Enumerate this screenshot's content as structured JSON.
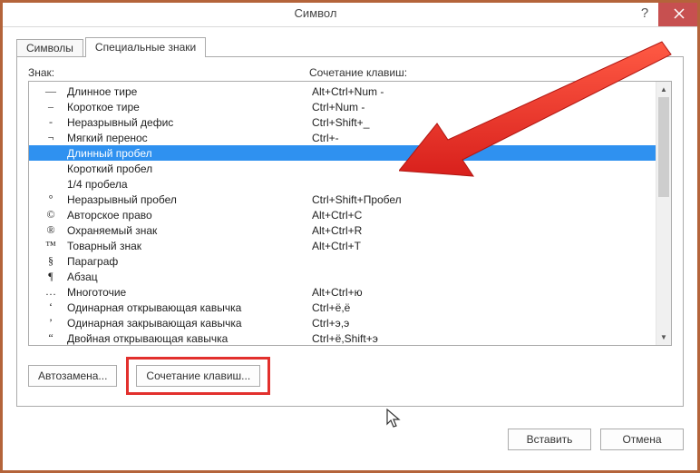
{
  "window": {
    "title": "Символ"
  },
  "tabs": {
    "symbols": "Символы",
    "special": "Специальные знаки"
  },
  "headers": {
    "sign": "Знак:",
    "shortcut": "Сочетание клавиш:"
  },
  "rows": [
    {
      "sym": "—",
      "name": "Длинное тире",
      "key": "Alt+Ctrl+Num -",
      "selected": false
    },
    {
      "sym": "–",
      "name": "Короткое тире",
      "key": "Ctrl+Num -",
      "selected": false
    },
    {
      "sym": "-",
      "name": "Неразрывный дефис",
      "key": "Ctrl+Shift+_",
      "selected": false
    },
    {
      "sym": "¬",
      "name": "Мягкий перенос",
      "key": "Ctrl+-",
      "selected": false
    },
    {
      "sym": "",
      "name": "Длинный пробел",
      "key": "",
      "selected": true
    },
    {
      "sym": "",
      "name": "Короткий пробел",
      "key": "",
      "selected": false
    },
    {
      "sym": "",
      "name": "1/4 пробела",
      "key": "",
      "selected": false
    },
    {
      "sym": "°",
      "name": "Неразрывный пробел",
      "key": "Ctrl+Shift+Пробел",
      "selected": false
    },
    {
      "sym": "©",
      "name": "Авторское право",
      "key": "Alt+Ctrl+C",
      "selected": false
    },
    {
      "sym": "®",
      "name": "Охраняемый знак",
      "key": "Alt+Ctrl+R",
      "selected": false
    },
    {
      "sym": "™",
      "name": "Товарный знак",
      "key": "Alt+Ctrl+T",
      "selected": false
    },
    {
      "sym": "§",
      "name": "Параграф",
      "key": "",
      "selected": false
    },
    {
      "sym": "¶",
      "name": "Абзац",
      "key": "",
      "selected": false
    },
    {
      "sym": "…",
      "name": "Многоточие",
      "key": "Alt+Ctrl+ю",
      "selected": false
    },
    {
      "sym": "‘",
      "name": "Одинарная открывающая кавычка",
      "key": "Ctrl+ё,ё",
      "selected": false
    },
    {
      "sym": "’",
      "name": "Одинарная закрывающая кавычка",
      "key": "Ctrl+э,э",
      "selected": false
    },
    {
      "sym": "“",
      "name": "Двойная открывающая кавычка",
      "key": "Ctrl+ё,Shift+э",
      "selected": false
    }
  ],
  "buttons": {
    "autocorrect": "Автозамена...",
    "shortcut": "Сочетание клавиш...",
    "insert": "Вставить",
    "cancel": "Отмена"
  }
}
